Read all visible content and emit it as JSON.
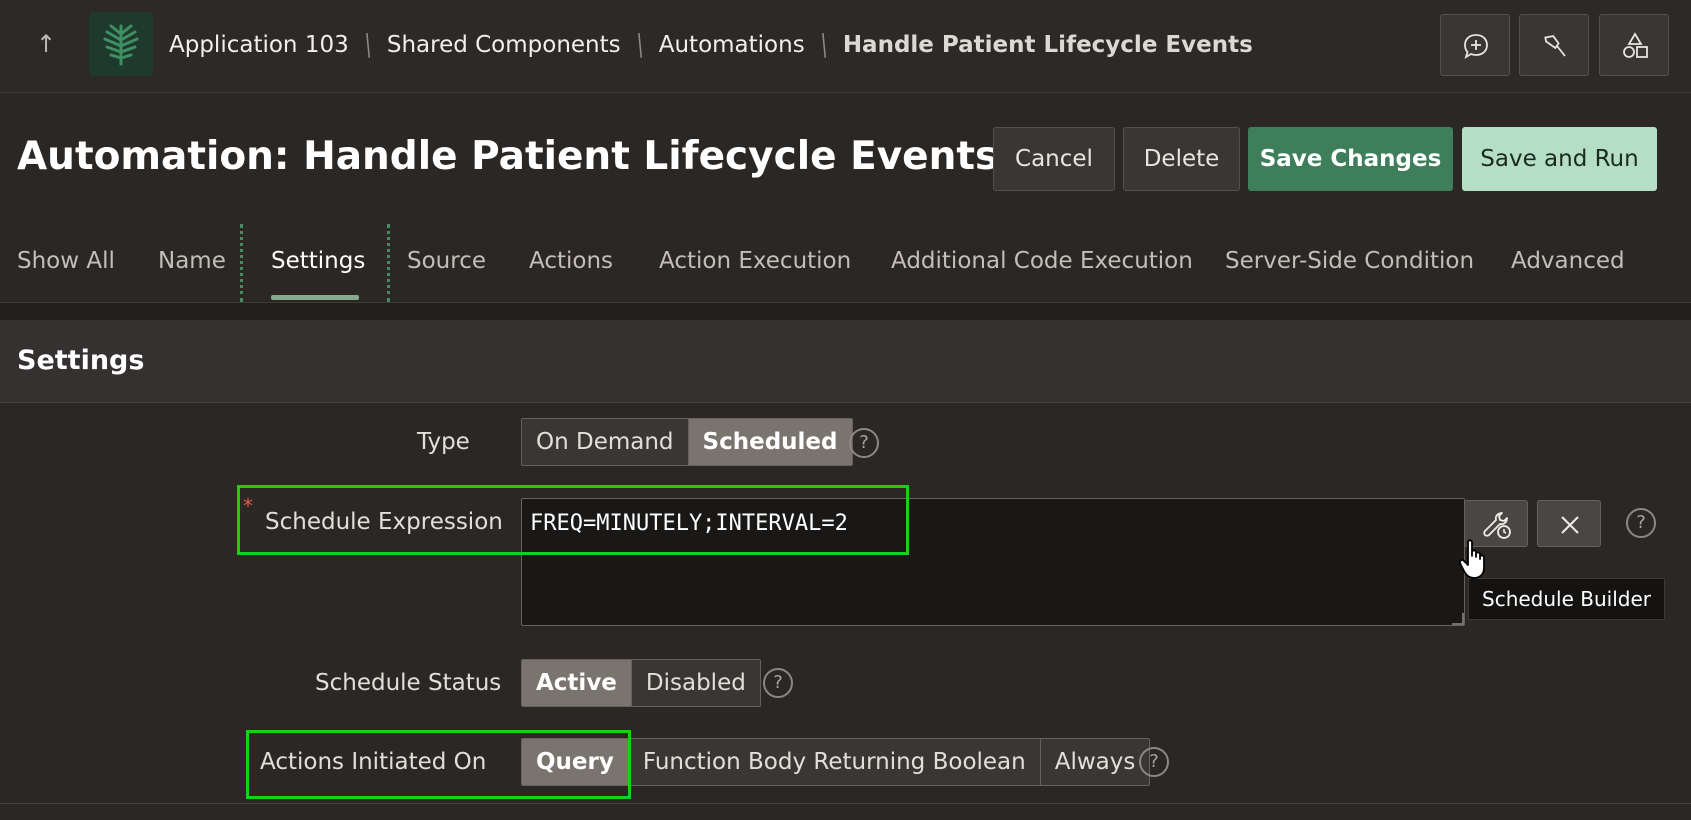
{
  "header": {
    "up_arrow": "↑",
    "logo_icon": "tree-leaf-icon",
    "breadcrumbs": [
      "Application 103",
      "Shared Components",
      "Automations",
      "Handle Patient Lifecycle Events"
    ],
    "separator": "\\",
    "tools": [
      "chat-plus-icon",
      "pin-icon",
      "shapes-icon"
    ]
  },
  "page": {
    "title": "Automation: Handle Patient Lifecycle Events",
    "buttons": {
      "cancel": "Cancel",
      "delete": "Delete",
      "save": "Save Changes",
      "save_run": "Save and Run"
    }
  },
  "tabs": [
    "Show All",
    "Name",
    "Settings",
    "Source",
    "Actions",
    "Action Execution",
    "Additional Code Execution",
    "Server-Side Condition",
    "Advanced"
  ],
  "active_tab": "Settings",
  "region": {
    "title": "Settings",
    "type": {
      "label": "Type",
      "options": [
        "On Demand",
        "Scheduled"
      ],
      "selected": "Scheduled"
    },
    "schedule_expression": {
      "label": "Schedule Expression",
      "required_mark": "*",
      "value": "FREQ=MINUTELY;INTERVAL=2",
      "builder_tooltip": "Schedule Builder"
    },
    "schedule_status": {
      "label": "Schedule Status",
      "options": [
        "Active",
        "Disabled"
      ],
      "selected": "Active"
    },
    "actions_initiated_on": {
      "label": "Actions Initiated On",
      "options": [
        "Query",
        "Function Body Returning Boolean",
        "Always"
      ],
      "selected": "Query"
    },
    "help_glyph": "?"
  },
  "colors": {
    "accent_green": "#3e7e5b",
    "highlight": "#17d01a",
    "required": "#e0584a"
  }
}
